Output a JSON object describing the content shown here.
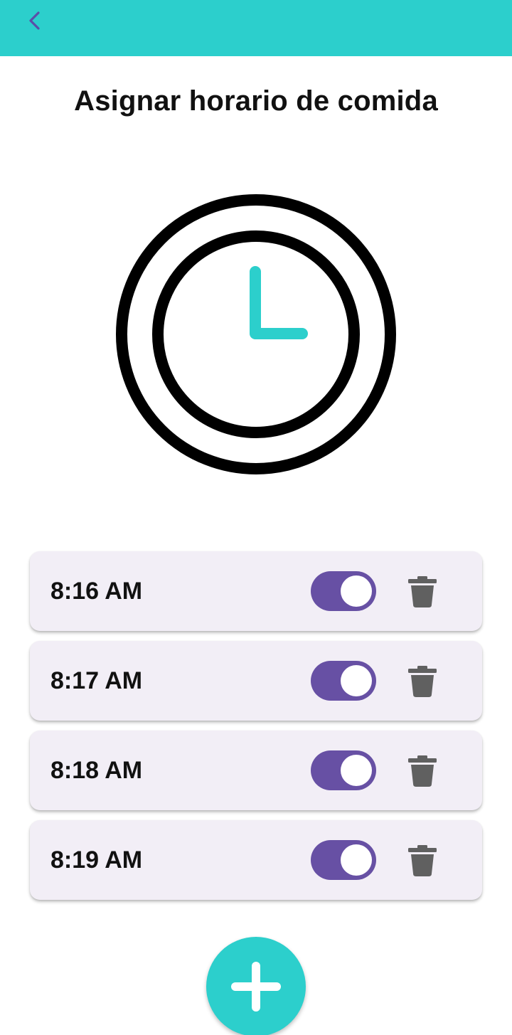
{
  "app_bar": {
    "back_icon": "chevron-left-icon",
    "background_color": "#2ccfcc",
    "icon_color": "#5b4fa8"
  },
  "title": "Asignar horario de comida",
  "illustration": {
    "icon": "clock-icon",
    "hand_color": "#2ccfcc"
  },
  "schedules": [
    {
      "time": "8:16 AM",
      "enabled": true
    },
    {
      "time": "8:17 AM",
      "enabled": true
    },
    {
      "time": "8:18 AM",
      "enabled": true
    },
    {
      "time": "8:19 AM",
      "enabled": true
    }
  ],
  "toggle_color": "#6750a4",
  "delete_icon": "trash-icon",
  "delete_icon_color": "#606060",
  "fab": {
    "icon": "plus-icon",
    "background_color": "#2ccfcc"
  }
}
